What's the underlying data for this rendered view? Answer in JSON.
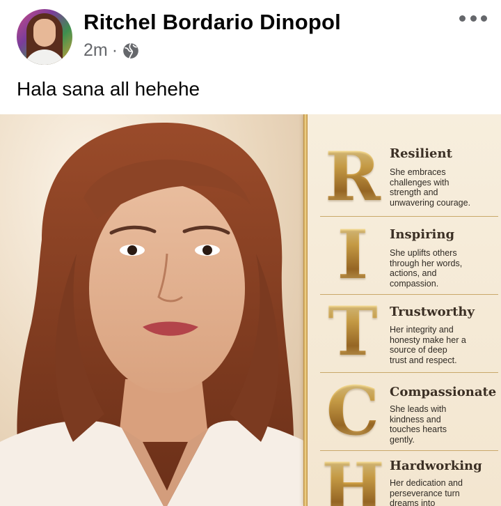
{
  "post": {
    "author_name": "Ritchel Bordario Dinopol",
    "time": "2m",
    "separator": "·",
    "audience_icon": "globe-icon",
    "more_icon": "more-horizontal-icon",
    "caption": "Hala sana all hehehe"
  },
  "image": {
    "traits": [
      {
        "letter": "R",
        "title": "Resilient",
        "lines": [
          "She embraces",
          "challenges with",
          "strength and",
          "unwavering courage."
        ]
      },
      {
        "letter": "I",
        "title": "Inspiring",
        "lines": [
          "She uplifts others",
          "through her words,",
          "actions, and",
          "compassion."
        ]
      },
      {
        "letter": "T",
        "title": "Trustworthy",
        "lines": [
          "Her integrity and",
          "honesty make her a",
          "source of deep",
          "trust and respect."
        ]
      },
      {
        "letter": "C",
        "title": "Compassionate",
        "lines": [
          "She leads with",
          "kindness and",
          "touches hearts",
          "gently."
        ]
      },
      {
        "letter": "H",
        "title": "Hardworking",
        "lines": [
          "Her dedication and",
          "perseverance turn",
          "dreams into"
        ]
      }
    ]
  },
  "colors": {
    "text_primary": "#050505",
    "text_secondary": "#65676b",
    "gold": "#d6a84a"
  }
}
